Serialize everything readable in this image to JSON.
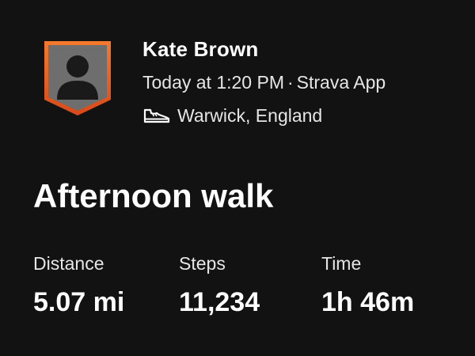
{
  "athlete": {
    "name": "Kate Brown",
    "avatar_icon": "person-silhouette-icon",
    "avatar_border_color": "#f26522"
  },
  "activity_meta": {
    "when": "Today at 1:20 PM",
    "separator": "·",
    "source": "Strava App",
    "sport_icon": "shoe-icon",
    "location": "Warwick, England"
  },
  "activity": {
    "title": "Afternoon walk"
  },
  "stats": [
    {
      "label": "Distance",
      "value": "5.07 mi"
    },
    {
      "label": "Steps",
      "value": "11,234"
    },
    {
      "label": "Time",
      "value": "1h 46m"
    }
  ],
  "colors": {
    "background": "#121212",
    "text": "#ffffff",
    "secondary_text": "#e6e6e6",
    "accent": "#f26522"
  }
}
